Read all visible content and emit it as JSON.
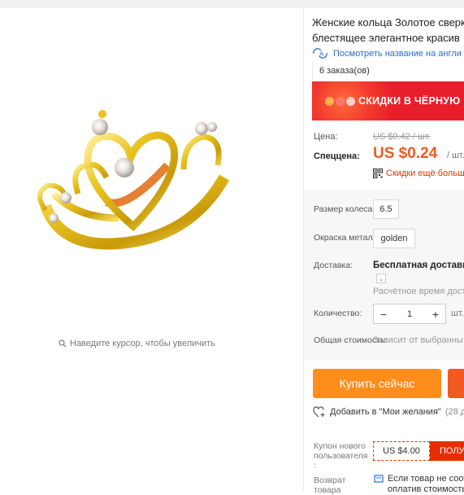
{
  "product": {
    "title_line1": "Женские кольца Золотое сверк",
    "title_line2": "блестящее элегантное красив",
    "translate_link": "Посмотреть название на англи",
    "orders": "6 заказа(ов)",
    "promo_banner": "СКИДКИ В ЧЁРНУЮ"
  },
  "gallery": {
    "zoom_hint": "Наведите курсор, чтобы увеличить"
  },
  "price": {
    "label": "Цена:",
    "old": "US $0.42 / шт.",
    "sale_label": "Спеццена:",
    "sale": "US $0.24",
    "per_unit": "/ шт.",
    "discount_link": "Скидки ещё больш"
  },
  "options": {
    "size_label": "Размер колеса:",
    "size_value": "6.5",
    "color_label": "Окраска металла:",
    "color_value": "golden",
    "shipping_label": "Доставка:",
    "shipping_value": "Бесплатная доставка",
    "shipping_eta": "Расчётное время дост",
    "quantity_label": "Количество:",
    "quantity_value": "1",
    "quantity_minus": "−",
    "quantity_plus": "+",
    "quantity_unit": "шт.",
    "total_label": "Общая стоимость:",
    "total_value": "Зависит от выбранны"
  },
  "actions": {
    "buy_now": "Купить сейчас",
    "wishlist": "Добавить в \"Мои желания\"",
    "wishlist_count": "(28 до"
  },
  "coupon": {
    "label": "Купон нового пользователя :",
    "amount": "US $4.00",
    "get": "ПОЛУ"
  },
  "returns": {
    "label": "Возврат товара",
    "line1": "Если товар не соот",
    "line2": "оплатив стоимость"
  },
  "colors": {
    "accent_orange": "#ff8d1c",
    "price_orange": "#f15a22",
    "promo_red": "#e81e2a",
    "link_blue": "#2a6bd2"
  },
  "icons": [
    "search-icon",
    "translate-icon",
    "qr-code-icon",
    "heart-add-icon",
    "info-icon",
    "chevron-down-icon"
  ]
}
